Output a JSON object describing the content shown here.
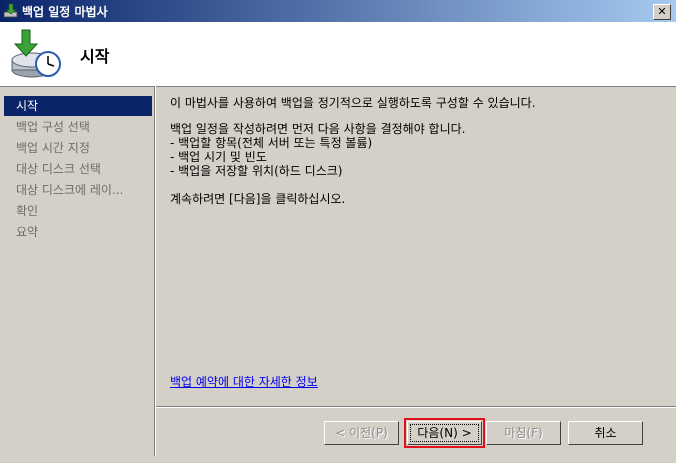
{
  "window": {
    "title": "백업 일정 마법사",
    "close_symbol": "✕"
  },
  "header": {
    "title": "시작",
    "icon": "backup-clock-icon"
  },
  "sidebar": {
    "items": [
      {
        "label": "시작",
        "active": true
      },
      {
        "label": "백업 구성 선택"
      },
      {
        "label": "백업 시간 지정"
      },
      {
        "label": "대상 디스크 선택"
      },
      {
        "label": "대상 디스크에 레이..."
      },
      {
        "label": "확인"
      },
      {
        "label": "요약"
      }
    ]
  },
  "content": {
    "intro": "이 마법사를 사용하여 백업을 정기적으로 실행하도록 구성할 수 있습니다.",
    "decide_heading": "백업 일정을 작성하려면 먼저 다음 사항을 결정해야 합니다.",
    "bullets": [
      "- 백업할 항목(전체 서버 또는 특정 볼륨)",
      "- 백업 시기 및 빈도",
      "- 백업을 저장할 위치(하드 디스크)"
    ],
    "continue": "계속하려면 [다음]을 클릭하십시오.",
    "link": "백업 예약에 대한 자세한 정보"
  },
  "buttons": {
    "prev": "< 이전(P)",
    "next": "다음(N) >",
    "finish": "마침(F)",
    "cancel": "취소"
  },
  "colors": {
    "selection": "#0a246a",
    "highlight_outline": "#e0111d",
    "link": "#0000ee"
  }
}
